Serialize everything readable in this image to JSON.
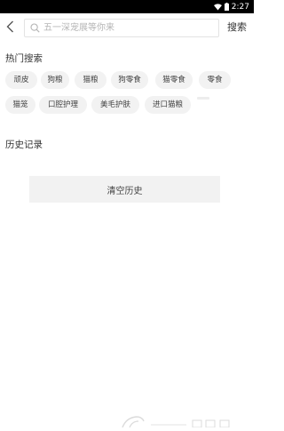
{
  "status_bar": {
    "time": "2:27"
  },
  "header": {
    "search_placeholder": "五一深宠展等你来",
    "search_label": "搜索"
  },
  "hot_search": {
    "title": "热门搜索",
    "tags": [
      "顽皮",
      "狗粮",
      "猫粮",
      "狗零食",
      "猫零食",
      "零食",
      "猫笼",
      "口腔护理",
      "美毛护肤",
      "进口猫粮"
    ]
  },
  "history": {
    "title": "历史记录",
    "clear_label": "清空历史"
  },
  "icons": {
    "back": "chevron-left-icon",
    "search": "search-icon",
    "wifi": "wifi-icon",
    "battery": "battery-icon"
  }
}
